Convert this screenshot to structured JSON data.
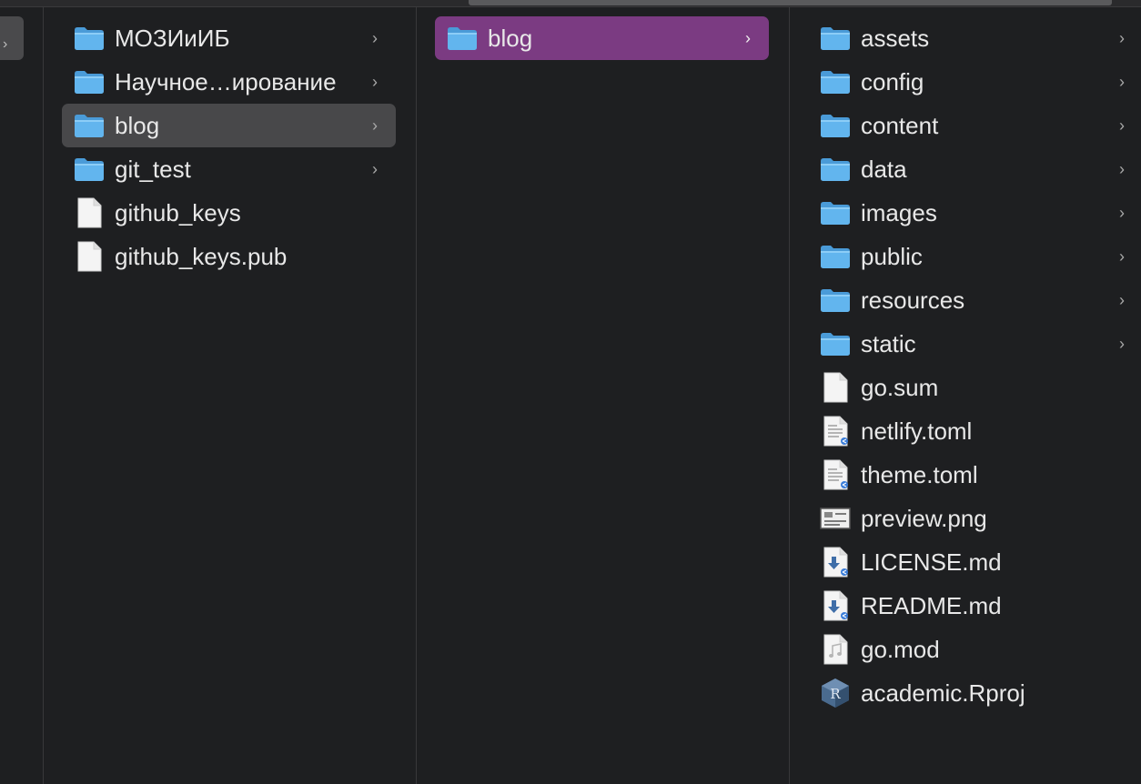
{
  "col1": {
    "items": [
      {
        "label": "МОЗИиИБ",
        "type": "folder",
        "icon": "folder-icon",
        "selected": false,
        "has_children": true
      },
      {
        "label": "Научное…ирование",
        "type": "folder",
        "icon": "folder-icon",
        "selected": false,
        "has_children": true
      },
      {
        "label": "blog",
        "type": "folder",
        "icon": "folder-icon",
        "selected": true,
        "has_children": true
      },
      {
        "label": "git_test",
        "type": "folder",
        "icon": "folder-icon",
        "selected": false,
        "has_children": true
      },
      {
        "label": "github_keys",
        "type": "file",
        "icon": "blank-document-icon",
        "selected": false,
        "has_children": false
      },
      {
        "label": "github_keys.pub",
        "type": "file",
        "icon": "blank-document-icon",
        "selected": false,
        "has_children": false
      }
    ]
  },
  "col2": {
    "items": [
      {
        "label": "blog",
        "type": "folder",
        "icon": "folder-icon",
        "selected": true,
        "has_children": true
      }
    ]
  },
  "col3": {
    "items": [
      {
        "label": "assets",
        "type": "folder",
        "icon": "folder-icon",
        "has_children": true
      },
      {
        "label": "config",
        "type": "folder",
        "icon": "folder-icon",
        "has_children": true
      },
      {
        "label": "content",
        "type": "folder",
        "icon": "folder-icon",
        "has_children": true
      },
      {
        "label": "data",
        "type": "folder",
        "icon": "folder-icon",
        "has_children": true
      },
      {
        "label": "images",
        "type": "folder",
        "icon": "folder-icon",
        "has_children": true
      },
      {
        "label": "public",
        "type": "folder",
        "icon": "folder-icon",
        "has_children": true
      },
      {
        "label": "resources",
        "type": "folder",
        "icon": "folder-icon",
        "has_children": true
      },
      {
        "label": "static",
        "type": "folder",
        "icon": "folder-icon",
        "has_children": true
      },
      {
        "label": "go.sum",
        "type": "file",
        "icon": "blank-document-icon",
        "has_children": false
      },
      {
        "label": "netlify.toml",
        "type": "file",
        "icon": "text-document-icon",
        "has_children": false
      },
      {
        "label": "theme.toml",
        "type": "file",
        "icon": "text-document-icon",
        "has_children": false
      },
      {
        "label": "preview.png",
        "type": "file",
        "icon": "image-file-icon",
        "has_children": false
      },
      {
        "label": "LICENSE.md",
        "type": "file",
        "icon": "markdown-file-icon",
        "has_children": false
      },
      {
        "label": "README.md",
        "type": "file",
        "icon": "markdown-file-icon",
        "has_children": false
      },
      {
        "label": "go.mod",
        "type": "file",
        "icon": "audio-file-icon",
        "has_children": false
      },
      {
        "label": "academic.Rproj",
        "type": "file",
        "icon": "rproject-file-icon",
        "has_children": false
      }
    ]
  },
  "colors": {
    "background": "#1e1f21",
    "selected_inactive": "#48484a",
    "selected_active": "#7b3b82",
    "folder_blue": "#5fb2ea"
  }
}
